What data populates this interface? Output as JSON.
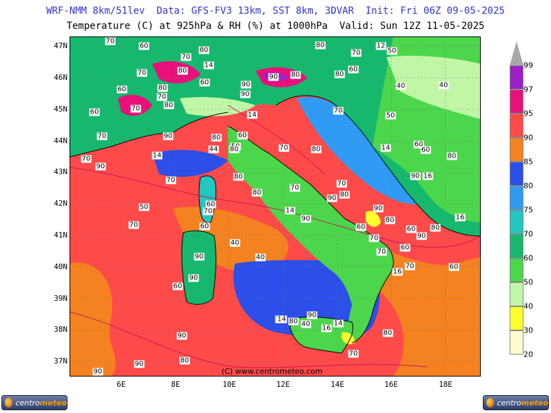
{
  "header": {
    "line1": "WRF-NMM 8km/51lev  Data: GFS-FV3 13km, SST 8km, 3DVAR  Init: Fri 06Z 09-05-2025",
    "line2": "Temperature (C) at 925hPa & RH (%) at 1000hPa  Valid: Sun 12Z 11-05-2025"
  },
  "axes": {
    "lat_labels": [
      "47N",
      "46N",
      "45N",
      "44N",
      "43N",
      "42N",
      "41N",
      "40N",
      "39N",
      "38N",
      "37N"
    ],
    "lon_labels": [
      "6E",
      "8E",
      "10E",
      "12E",
      "14E",
      "16E",
      "18E"
    ]
  },
  "legend": {
    "levels": [
      "99",
      "97",
      "95",
      "90",
      "85",
      "80",
      "75",
      "70",
      "60",
      "50",
      "40",
      "30",
      "20"
    ],
    "colors": [
      "#a9a9a9",
      "#9b1fc7",
      "#e8107a",
      "#ff4a4a",
      "#f58220",
      "#2b4fe8",
      "#2f9bf5",
      "#21c7c0",
      "#16b86e",
      "#4cd64c",
      "#bff7a6",
      "#ffff2e",
      "#fffbd0"
    ]
  },
  "map": {
    "colors": {
      "sea_red": "#ff4a4a",
      "sea_orange": "#f58220",
      "sea_blue": "#2b4fe8",
      "sky": "#2f9bf5",
      "green": "#16b86e",
      "lightgreen": "#4cd64c",
      "palegreen": "#bff7a6",
      "magenta": "#e8107a",
      "purple": "#9b1fc7",
      "yellow": "#ffff2e",
      "teal": "#21c7c0"
    },
    "contour_labels": [
      "70",
      "60",
      "70",
      "80",
      "12",
      "50",
      "70",
      "80",
      "14",
      "70",
      "90",
      "80",
      "80",
      "60",
      "40",
      "70",
      "80",
      "60",
      "60",
      "80",
      "70",
      "90",
      "90",
      "80",
      "14",
      "70",
      "40",
      "70",
      "60",
      "50",
      "60",
      "90",
      "70",
      "60",
      "80",
      "44",
      "50",
      "70",
      "60",
      "14",
      "80",
      "90",
      "70",
      "80",
      "14",
      "80",
      "90",
      "16",
      "80",
      "70",
      "80",
      "70",
      "90",
      "70",
      "80",
      "50",
      "60",
      "70",
      "14",
      "90",
      "16",
      "80",
      "60",
      "80",
      "90",
      "40",
      "60",
      "70",
      "70",
      "60",
      "90",
      "60",
      "70",
      "40",
      "90",
      "60",
      "90",
      "16",
      "70",
      "60",
      "90",
      "80",
      "40",
      "90",
      "14",
      "16",
      "90",
      "14",
      "80",
      "90",
      "70",
      "80",
      "90"
    ],
    "credit": "(C) www.centrometeo.com"
  },
  "logos": {
    "brand_a": "centro",
    "brand_b": "meteo"
  }
}
